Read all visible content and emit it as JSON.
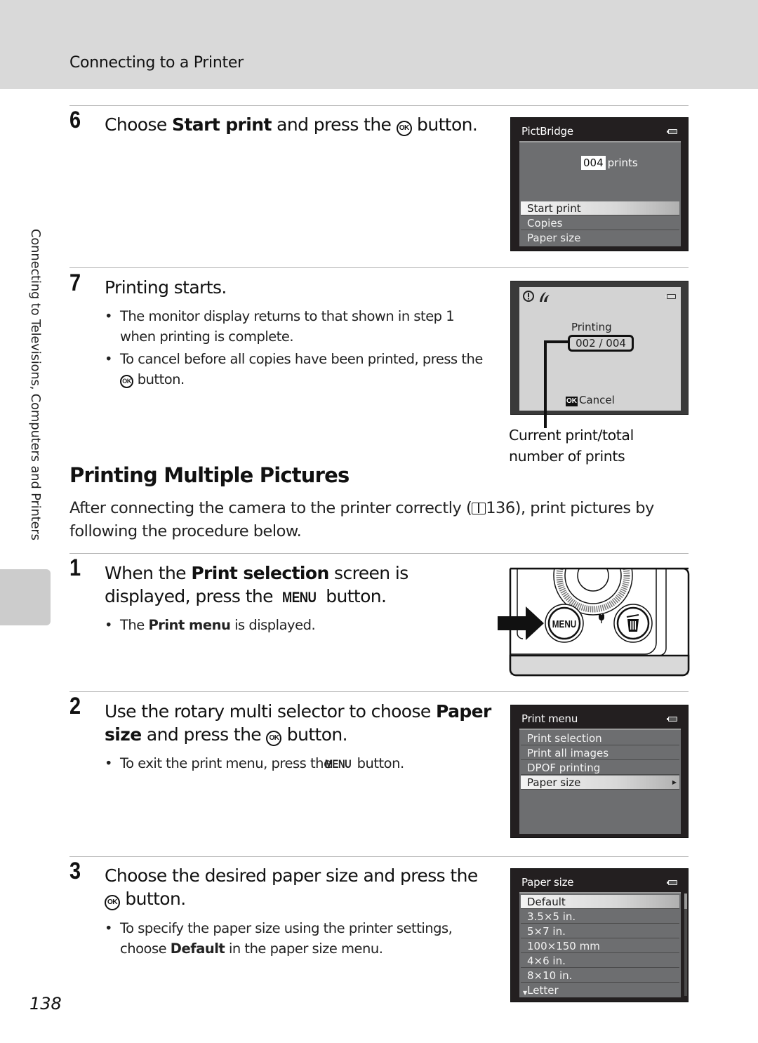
{
  "header": {
    "title": "Connecting to a Printer"
  },
  "side_tab": {
    "label": "Connecting to Televisions, Computers and Printers"
  },
  "page_number": "138",
  "steps_top": [
    {
      "number": "6",
      "text_before": "Choose ",
      "text_bold": "Start print",
      "text_after_1": " and press the ",
      "button_glyph": "OK",
      "text_after_2": " button."
    },
    {
      "number": "7",
      "text": "Printing starts.",
      "bullets": [
        {
          "text": "The monitor display returns to that shown in step 1 when printing is complete."
        },
        {
          "text_before": "To cancel before all copies have been printed, press the ",
          "button_glyph": "OK",
          "text_after": " button."
        }
      ]
    }
  ],
  "screens": {
    "pictbridge": {
      "title": "PictBridge",
      "prints_count": "004",
      "prints_label": "prints",
      "items": [
        "Start print",
        "Copies",
        "Paper size"
      ],
      "selected_index": 0
    },
    "printing": {
      "status_label": "Printing",
      "progress_text": "002 / 004",
      "current": 2,
      "total": 4,
      "cancel_button_glyph": "OK",
      "cancel_label": "Cancel",
      "callout": [
        "Current print/total",
        "number of prints"
      ]
    },
    "print_menu": {
      "title": "Print menu",
      "items": [
        "Print selection",
        "Print all images",
        "DPOF printing",
        "Paper size"
      ],
      "selected_index": 3
    },
    "paper_size": {
      "title": "Paper size",
      "items": [
        "Default",
        "3.5×5 in.",
        "5×7 in.",
        "100×150 mm",
        "4×6 in.",
        "8×10 in.",
        "Letter"
      ],
      "selected_index": 0
    },
    "camera": {
      "menu_button_label": "MENU"
    }
  },
  "section": {
    "title": "Printing Multiple Pictures",
    "intro_before": "After connecting the camera to the printer correctly (",
    "intro_ref": "136",
    "intro_after": "), print pictures by following the procedure below."
  },
  "steps_bottom": [
    {
      "number": "1",
      "text_before": "When the ",
      "text_bold": "Print selection",
      "text_after_1": " screen is displayed, press the ",
      "button_glyph": "MENU",
      "text_after_2": " button.",
      "bullet_before": "The ",
      "bullet_bold": "Print menu",
      "bullet_after": " is displayed."
    },
    {
      "number": "2",
      "text_before": "Use the rotary multi selector to choose ",
      "text_bold": "Paper size",
      "text_after_1": " and press the ",
      "button_glyph": "OK",
      "text_after_2": " button.",
      "bullet_before": "To exit the print menu, press the ",
      "bullet_glyph": "MENU",
      "bullet_after": " button."
    },
    {
      "number": "3",
      "text_before": "Choose the desired paper size and press the ",
      "button_glyph": "OK",
      "text_after": " button.",
      "bullet_before": "To specify the paper size using the printer settings, choose ",
      "bullet_bold": "Default",
      "bullet_after": " in the paper size menu."
    }
  ]
}
